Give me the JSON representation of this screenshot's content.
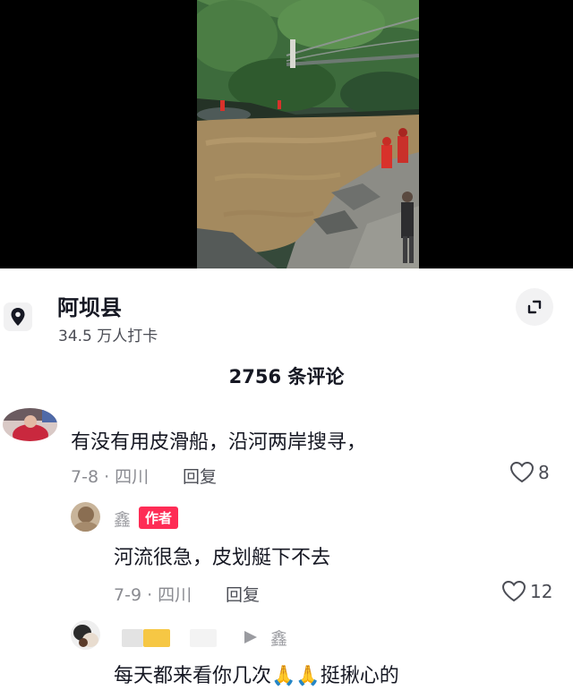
{
  "location": {
    "name": "阿坝县",
    "checkins": "34.5 万人打卡"
  },
  "comments_header": {
    "count_label": "2756 条评论"
  },
  "comments": [
    {
      "text": "有没有用皮滑船，沿河两岸搜寻，",
      "meta": "7-8 · 四川",
      "reply_label": "回复",
      "likes": "8"
    },
    {
      "username": "鑫",
      "badge": "作者",
      "text": "河流很急，皮划艇下不去",
      "meta": "7-9 · 四川",
      "reply_label": "回复",
      "likes": "12"
    },
    {
      "reply_to": "鑫",
      "text": "每天都来看你几次🙏🙏挺揪心的"
    }
  ],
  "colors": {
    "author_badge": "#fe2c55",
    "text_primary": "#161823",
    "text_secondary": "#8a8b91"
  }
}
